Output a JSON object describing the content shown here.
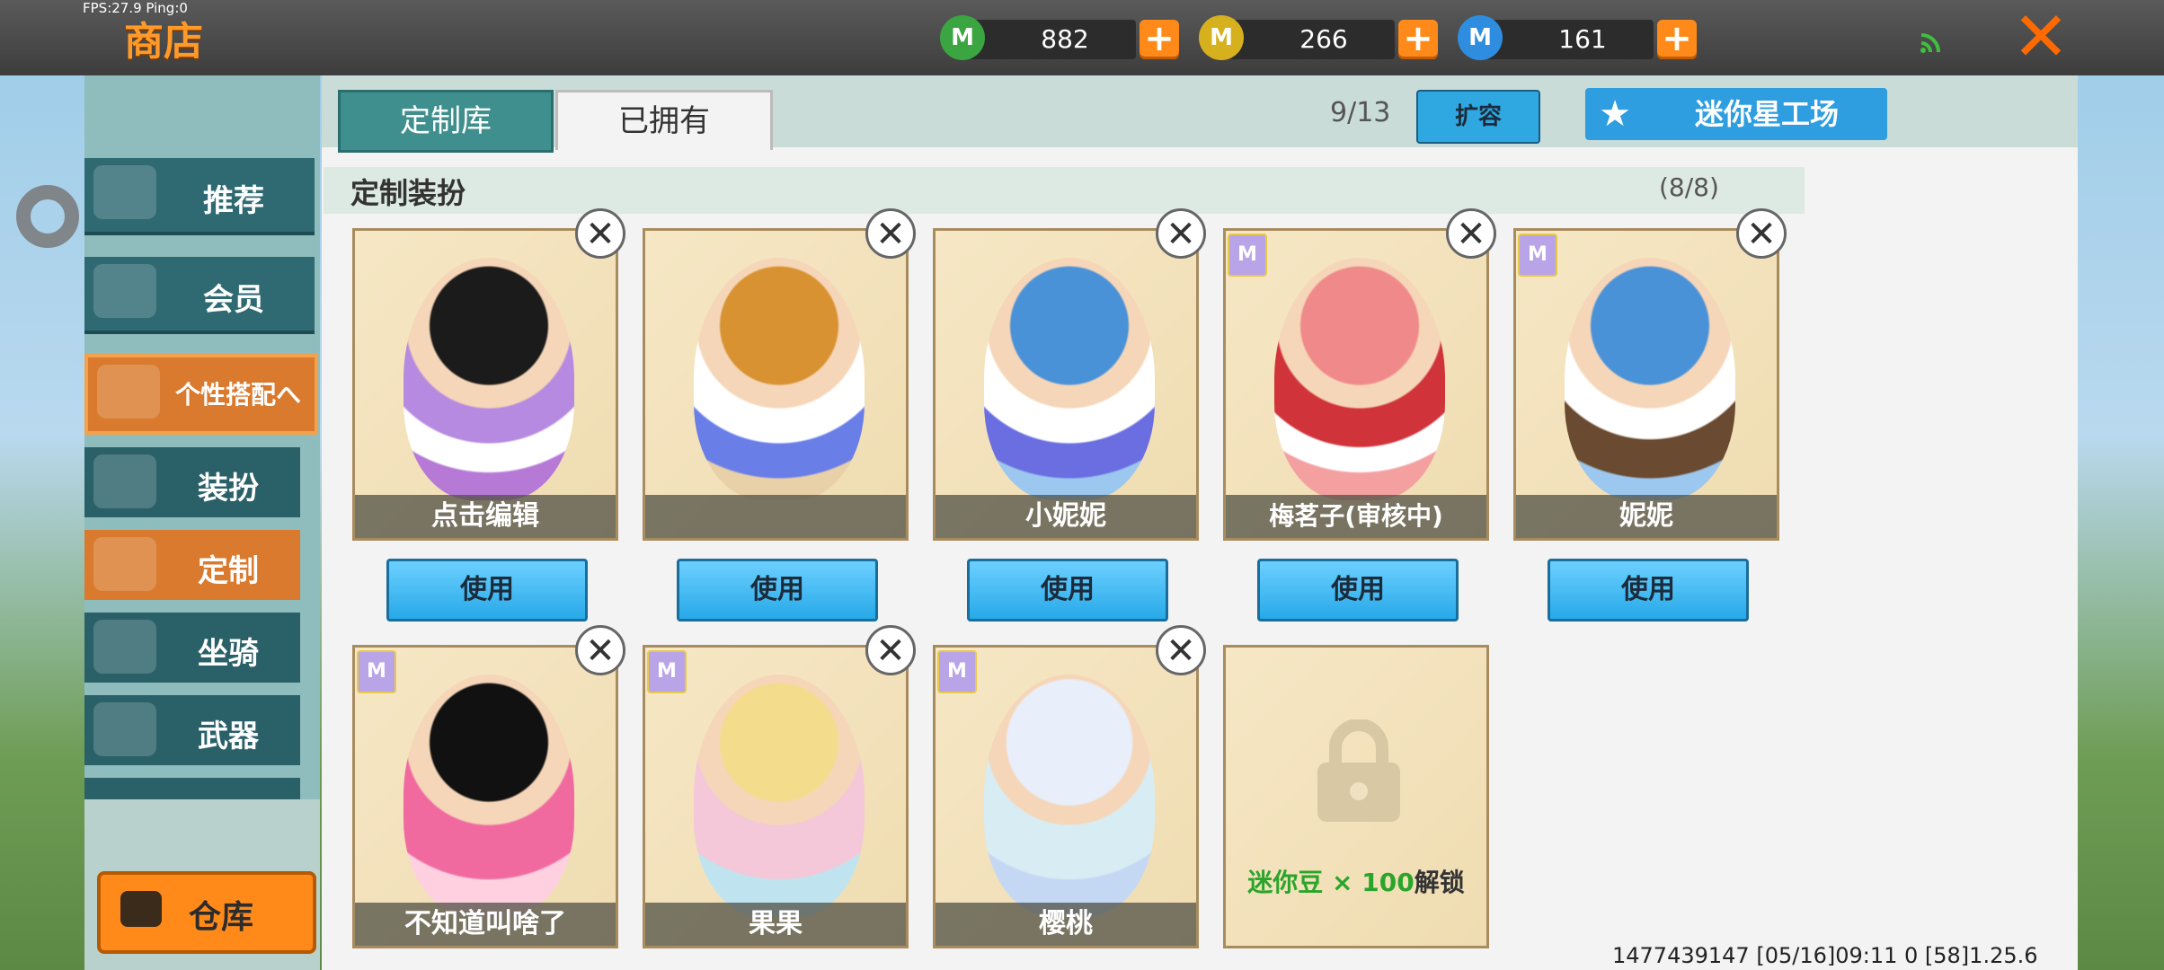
{
  "header": {
    "fps": "FPS:27.9  Ping:0",
    "title": "商店",
    "currencies": [
      {
        "icon": "green-m-coin-icon",
        "value": "882",
        "color": "#3aa541"
      },
      {
        "icon": "gold-m-coin-icon",
        "value": "266",
        "color": "#d7b01e"
      },
      {
        "icon": "blue-m-coin-icon",
        "value": "161",
        "color": "#2f8de0"
      }
    ],
    "add_label": "+",
    "close_label": "✕"
  },
  "sidebar": {
    "items": [
      {
        "label": "推荐"
      },
      {
        "label": "会员"
      },
      {
        "label": "个性搭配へ"
      },
      {
        "label": "装扮"
      },
      {
        "label": "定制"
      },
      {
        "label": "坐骑"
      },
      {
        "label": "武器"
      }
    ],
    "warehouse_label": "仓库"
  },
  "tabs": [
    {
      "label": "定制库"
    },
    {
      "label": "已拥有"
    }
  ],
  "toolbar": {
    "slot_count": "9/13",
    "expand_label": "扩容",
    "workshop_label": "迷你星工场"
  },
  "section": {
    "title": "定制装扮",
    "count": "(8/8)"
  },
  "cards": [
    {
      "name": "点击编辑",
      "vip": false,
      "use_label": "使用",
      "delete_label": "✕"
    },
    {
      "name": "",
      "vip": false,
      "use_label": "使用",
      "delete_label": "✕"
    },
    {
      "name": "小妮妮",
      "vip": false,
      "use_label": "使用",
      "delete_label": "✕"
    },
    {
      "name": "梅茗子(审核中)",
      "vip": true,
      "use_label": "使用",
      "delete_label": "✕"
    },
    {
      "name": "妮妮",
      "vip": true,
      "use_label": "使用",
      "delete_label": "✕"
    },
    {
      "name": "不知道叫啥了",
      "vip": true,
      "delete_label": "✕"
    },
    {
      "name": "果果",
      "vip": true,
      "delete_label": "✕"
    },
    {
      "name": "樱桃",
      "vip": true,
      "delete_label": "✕"
    }
  ],
  "locked_slot": {
    "text_green": "迷你豆 × 100",
    "text_dark": "解锁"
  },
  "footer": "1477439147   [05/16]09:11 0   [58]1.25.6",
  "colors": {
    "accent_orange": "#ff8a1a",
    "teal": "#3f8f8e",
    "use_blue": "#27a9e8",
    "unlock_green": "#2aa52a"
  }
}
